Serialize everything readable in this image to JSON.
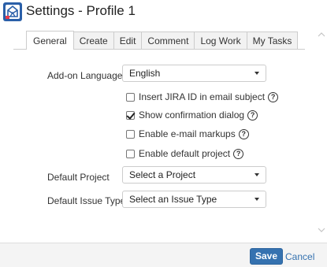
{
  "window": {
    "title": "Settings - Profile 1",
    "icon": "app-logo-icon"
  },
  "tabs": [
    {
      "label": "General",
      "active": true
    },
    {
      "label": "Create",
      "active": false
    },
    {
      "label": "Edit",
      "active": false
    },
    {
      "label": "Comment",
      "active": false
    },
    {
      "label": "Log Work",
      "active": false
    },
    {
      "label": "My Tasks",
      "active": false
    }
  ],
  "form": {
    "language": {
      "label": "Add-on Language",
      "value": "English"
    },
    "options": [
      {
        "label": "Insert JIRA ID in email subject",
        "checked": false
      },
      {
        "label": "Show confirmation dialog",
        "checked": true
      },
      {
        "label": "Enable e-mail markups",
        "checked": false
      },
      {
        "label": "Enable default project",
        "checked": false
      }
    ],
    "default_project": {
      "label": "Default Project",
      "value": "Select a Project"
    },
    "default_issue_type": {
      "label": "Default Issue Type",
      "value": "Select an Issue Type"
    }
  },
  "footer": {
    "save_label": "Save",
    "cancel_label": "Cancel"
  },
  "colors": {
    "accent": "#3572b0",
    "icon_bg": "#2a5fa8",
    "icon_accent": "#e8394a"
  }
}
